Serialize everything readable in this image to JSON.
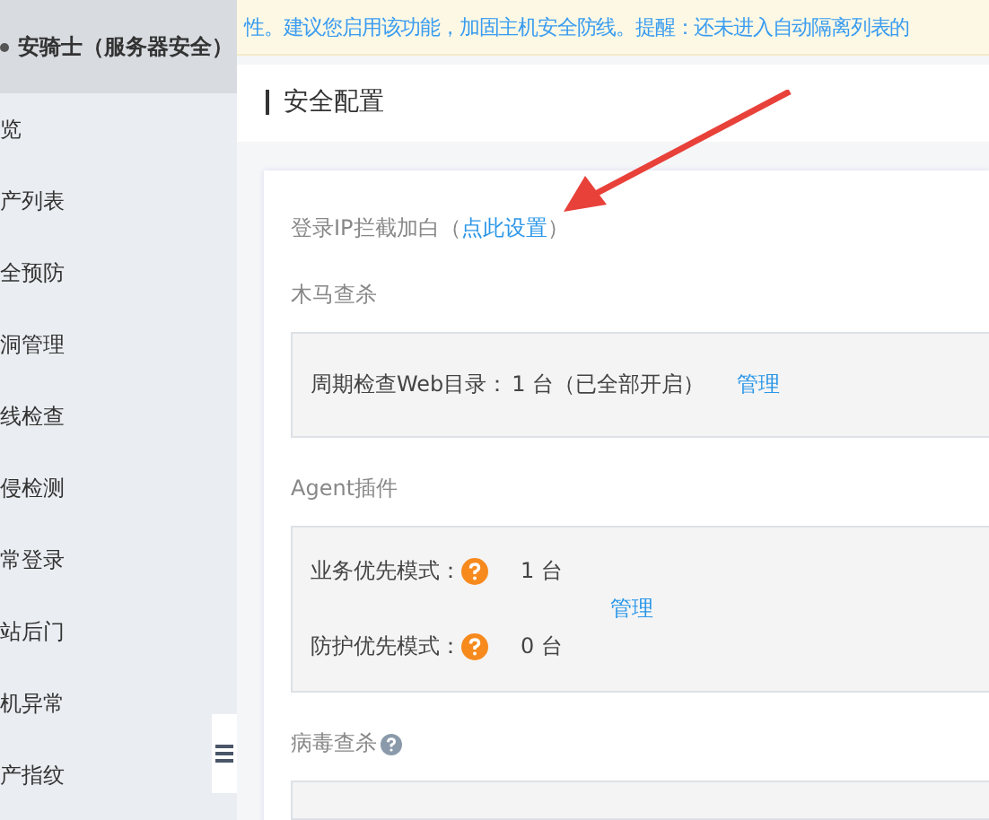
{
  "sidebar": {
    "product": "安骑士（服务器安全）",
    "items": [
      {
        "label": "览"
      },
      {
        "label": "产列表"
      },
      {
        "label": "全预防"
      },
      {
        "label": "洞管理"
      },
      {
        "label": "线检查"
      },
      {
        "label": "侵检测"
      },
      {
        "label": "常登录"
      },
      {
        "label": "站后门"
      },
      {
        "label": "机异常"
      },
      {
        "label": "产指纹"
      }
    ]
  },
  "notice": {
    "text": "性。建议您启用该功能，加固主机安全防线。提醒：还未进入自动隔离列表的"
  },
  "page_title": "安全配置",
  "ip_whitelist": {
    "label": "登录IP拦截加白（",
    "link": "点此设置",
    "suffix": "）"
  },
  "sections": [
    {
      "kind": "webdir",
      "title": "木马查杀",
      "label": "周期检查Web目录：",
      "value": "1 台（已全部开启）",
      "link": "管理"
    },
    {
      "kind": "agent",
      "title": "Agent插件",
      "rows": [
        {
          "label": "业务优先模式：",
          "value": "1 台"
        },
        {
          "label": "防护优先模式：",
          "value": "0 台"
        }
      ],
      "link": "管理"
    },
    {
      "kind": "virus",
      "title": "病毒查杀"
    }
  ]
}
